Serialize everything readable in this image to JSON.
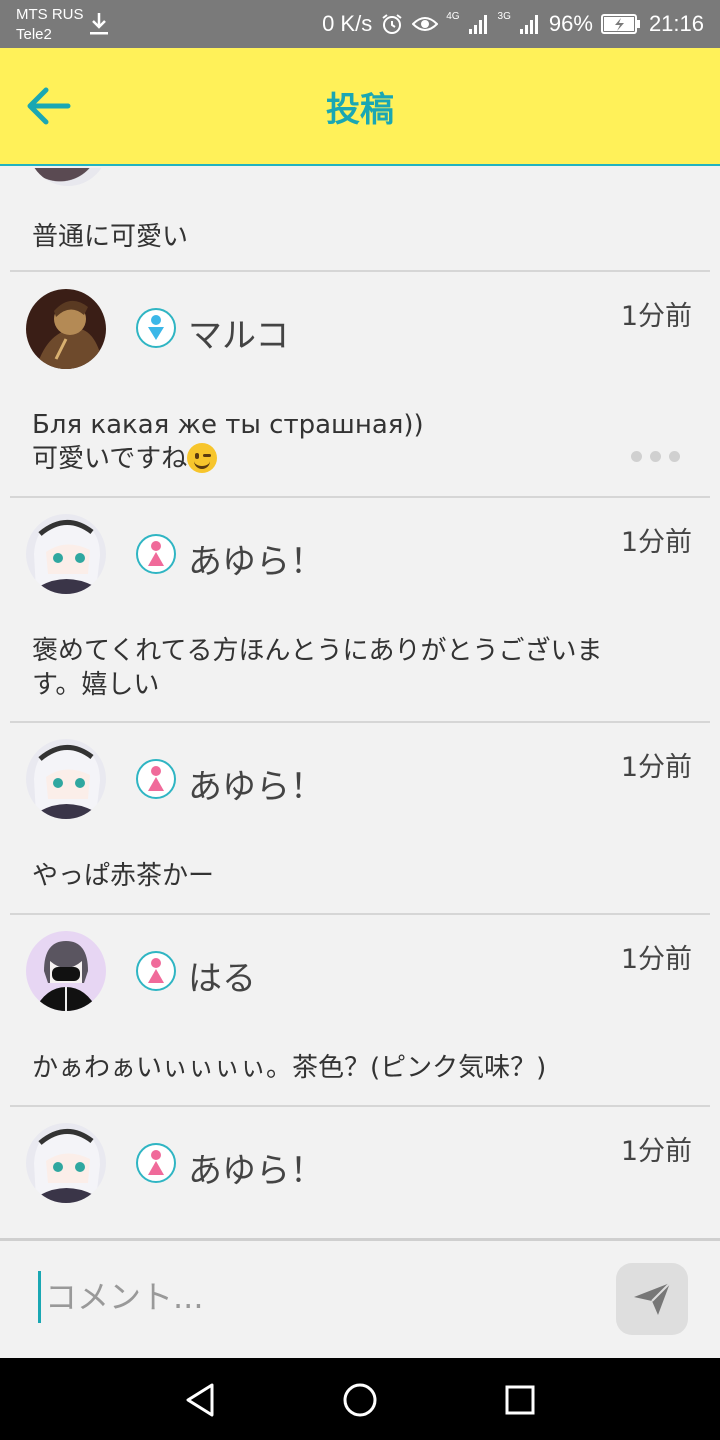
{
  "status_bar": {
    "carrier_1": "MTS RUS",
    "carrier_2": "Tele2",
    "speed": "0 K/s",
    "net_1": "4G",
    "net_2": "3G",
    "battery": "96%",
    "time": "21:16"
  },
  "app_bar": {
    "title": "投稿"
  },
  "top_partial": {
    "text": "普通に可愛い"
  },
  "posts": [
    {
      "username": "マルコ",
      "gender": "male",
      "time": "1分前",
      "text_line1": "Бля какая же ты страшная))",
      "text_line2": "可愛いですね",
      "emoji": "winking-face"
    },
    {
      "username": "あゆら！",
      "gender": "female",
      "time": "1分前",
      "text_line1": "褒めてくれてる方ほんとうにありがとうございま",
      "text_line2": "す。嬉しい"
    },
    {
      "username": "あゆら！",
      "gender": "female",
      "time": "1分前",
      "text_line1": "やっぱ赤茶かー"
    },
    {
      "username": "はる",
      "gender": "female",
      "time": "1分前",
      "text_line1": "かぁわぁいぃぃぃぃ。茶色？(ピンク気味？)"
    },
    {
      "username": "あゆら！",
      "gender": "female",
      "time": "1分前"
    }
  ],
  "comment_bar": {
    "placeholder": "コメント..."
  },
  "colors": {
    "app_bar_bg": "#fff159",
    "accent": "#1aa7b3",
    "male_icon": "#3bb7e8",
    "female_icon": "#f06a9a"
  }
}
